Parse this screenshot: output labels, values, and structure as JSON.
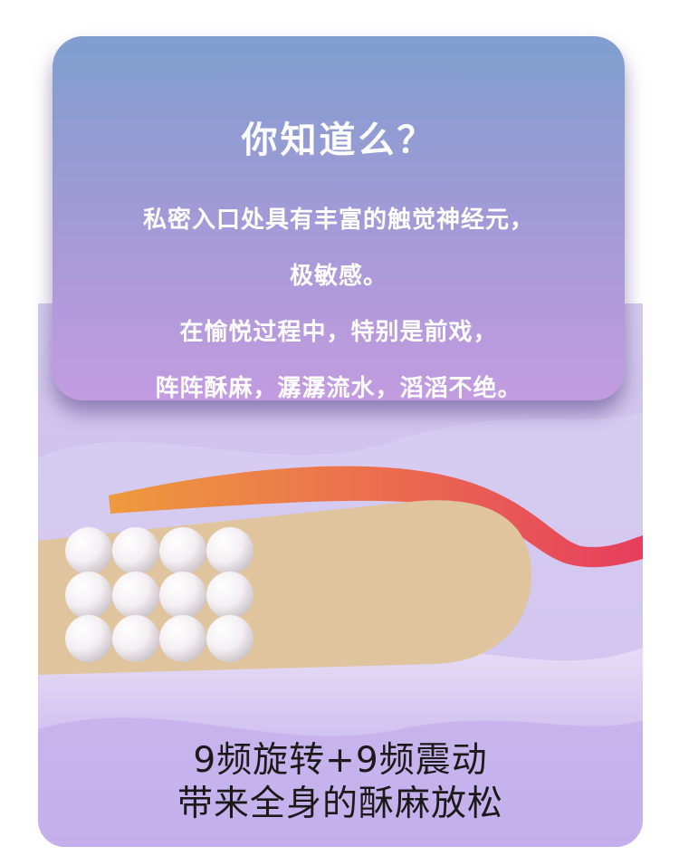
{
  "info_card": {
    "title": "你知道么？",
    "lines": [
      "私密入口处具有丰富的触觉神经元，",
      "极敏感。",
      "在愉悦过程中，特别是前戏，",
      "阵阵酥麻，潺潺流水，滔滔不绝。"
    ]
  },
  "caption": {
    "line1": "9频旋转+9频震动",
    "line2": "带来全身的酥麻放松"
  },
  "colors": {
    "card_top": "#7f9ecf",
    "card_bottom": "#c39be0",
    "product_body": "#dfc49d",
    "band_start": "#ee9a3e",
    "band_end": "#e63e5e"
  }
}
